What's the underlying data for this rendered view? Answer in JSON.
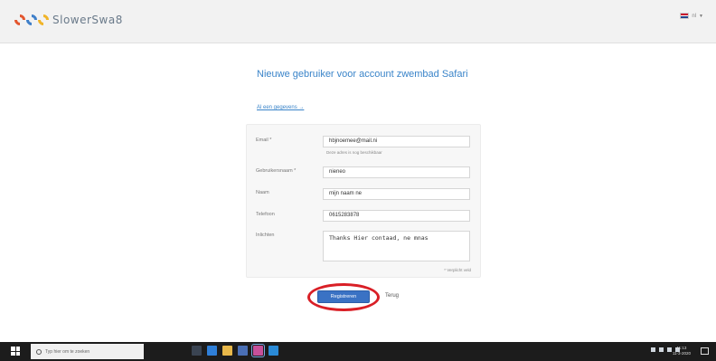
{
  "header": {
    "logo_text": "SlowerSwa8",
    "language": "nl",
    "colors": {
      "bar": "#f2f2f2",
      "accent": "#3a84c9"
    }
  },
  "page": {
    "title": "Nieuwe gebruiker voor account zwembad Safari",
    "login_link": "Al een gegevens →"
  },
  "form": {
    "email": {
      "label": "Email *",
      "value": "hbjnoemee@mail.ni",
      "hint": "Deze adres is nog beschikbaar"
    },
    "username": {
      "label": "Gebruikersnaam *",
      "value": "nieneo"
    },
    "name": {
      "label": "Naam",
      "value": "mijn naam ne"
    },
    "phone": {
      "label": "Telefoon",
      "value": "0615283878"
    },
    "note": {
      "label": "Inlichten",
      "value": "Thanks Hier contaad, ne mnas"
    },
    "required_note": "* Verplicht veld"
  },
  "actions": {
    "register_label": "Registreren",
    "back_label": "Terug",
    "highlight_color": "#d91f26"
  },
  "taskbar": {
    "search_placeholder": "Typ hier om te zoeken",
    "clock_time": "11:13",
    "clock_date": "11-3-2020",
    "icons": [
      "task-view-icon",
      "edge-icon",
      "explorer-icon",
      "store-icon",
      "photos-icon",
      "vscode-icon"
    ]
  }
}
